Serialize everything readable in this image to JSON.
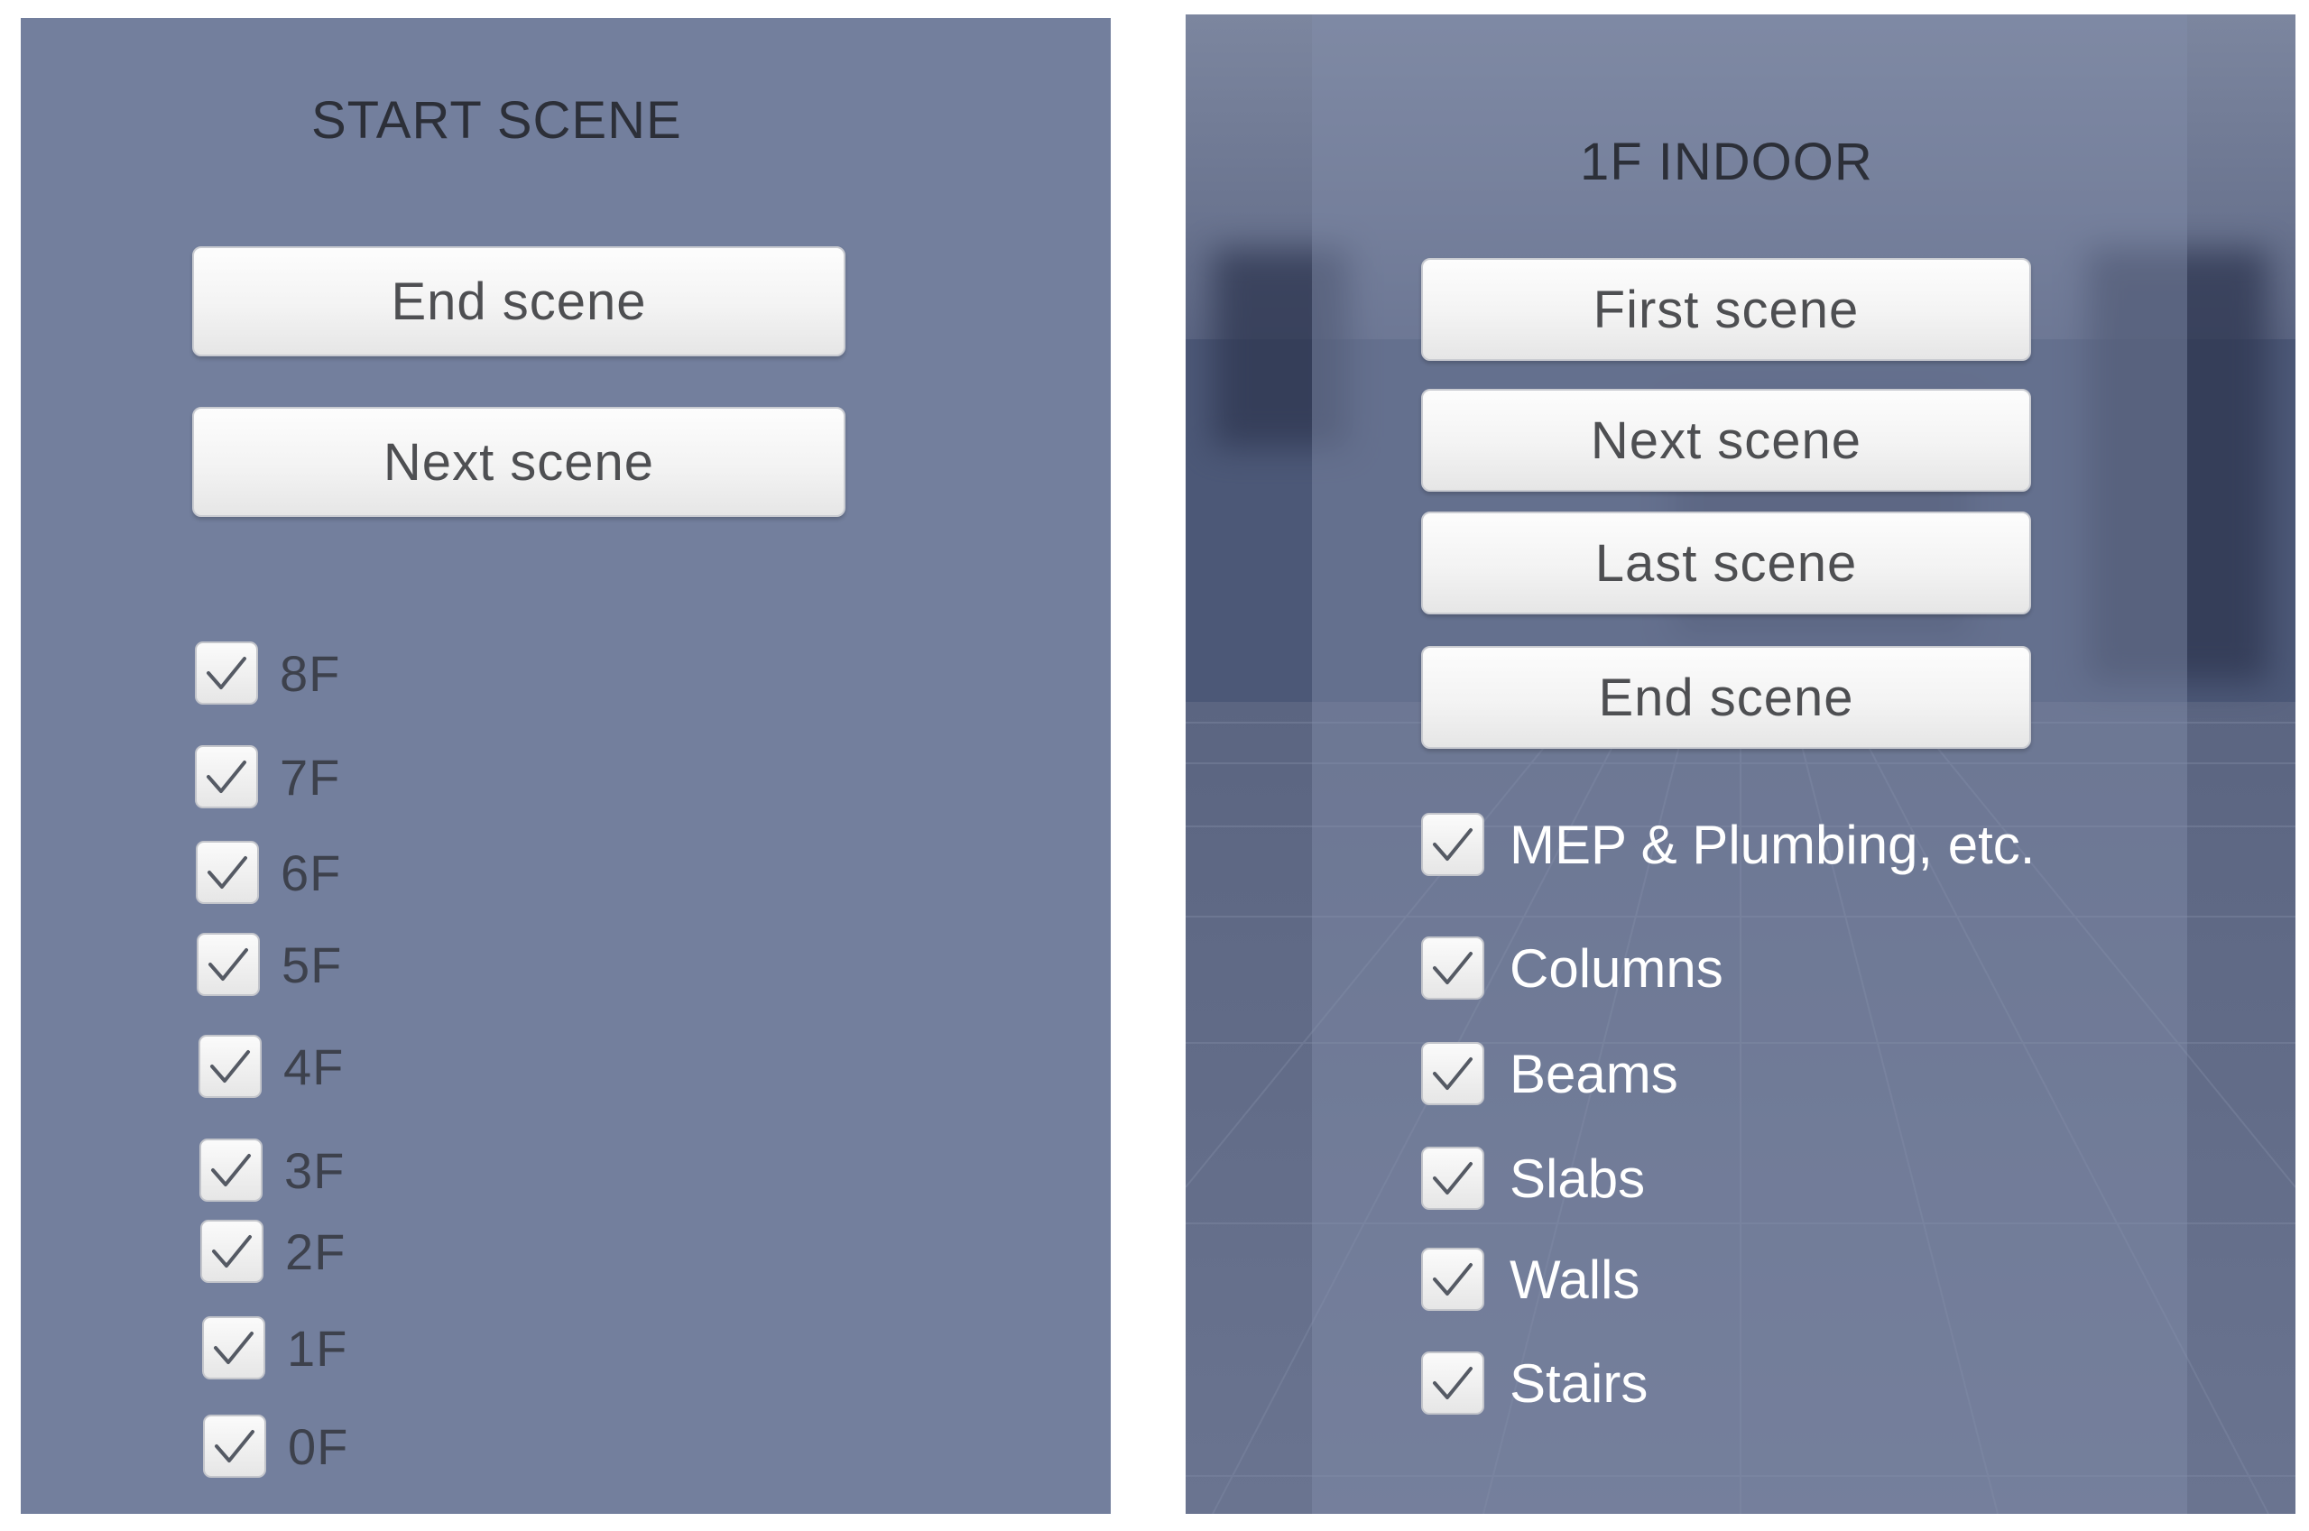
{
  "start_scene": {
    "title": "START SCENE",
    "buttons": [
      "End scene",
      "Next scene"
    ],
    "floors": [
      {
        "label": "8F",
        "checked": true
      },
      {
        "label": "7F",
        "checked": true
      },
      {
        "label": "6F",
        "checked": true
      },
      {
        "label": "5F",
        "checked": true
      },
      {
        "label": "4F",
        "checked": true
      },
      {
        "label": "3F",
        "checked": true
      },
      {
        "label": "2F",
        "checked": true
      },
      {
        "label": "1F",
        "checked": true
      },
      {
        "label": "0F",
        "checked": true
      }
    ]
  },
  "indoor_scene": {
    "title": "1F INDOOR",
    "buttons": [
      "First scene",
      "Next scene",
      "Last scene",
      "End scene"
    ],
    "layers": [
      {
        "label": "MEP & Plumbing, etc.",
        "checked": true
      },
      {
        "label": "Columns",
        "checked": true
      },
      {
        "label": "Beams",
        "checked": true
      },
      {
        "label": "Slabs",
        "checked": true
      },
      {
        "label": "Walls",
        "checked": true
      },
      {
        "label": "Stairs",
        "checked": true
      }
    ]
  },
  "icons": {
    "checkbox_mark": "checkmark-icon"
  },
  "colors": {
    "left_panel_bg": "#737f9d",
    "button_text": "#4e4f52",
    "right_label_text": "#ffffff"
  }
}
